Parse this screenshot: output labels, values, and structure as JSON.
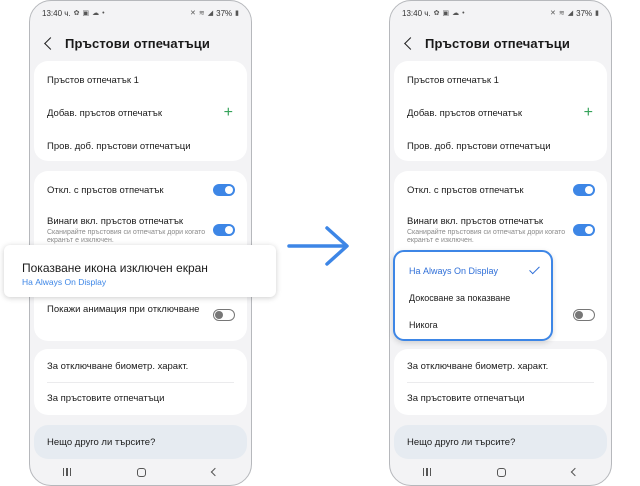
{
  "status_bar": {
    "time": "13:40 ч.",
    "battery": "37%"
  },
  "settings": {
    "title": "Пръстови отпечатъци",
    "card1": [
      {
        "label": "Пръстов отпечатък 1"
      },
      {
        "label": "Добав. пръстов отпечатък"
      },
      {
        "label": "Пров. доб. пръстови отпечатъци"
      }
    ],
    "card2": [
      {
        "label": "Откл. с пръстов отпечатък",
        "toggle": "on"
      },
      {
        "label": "Винаги вкл. пръстов отпечатък",
        "sub": "Сканирайте пръстовия си отпечатък дори когато екранът е изключен.",
        "toggle": "on"
      },
      {
        "label": "Показване икона изключен екран",
        "value": "На Always On Display"
      },
      {
        "label": "Покажи анимация при отключване",
        "toggle": "off"
      }
    ],
    "card3": [
      {
        "label": "За отключване биометр. характ."
      },
      {
        "label": "За пръстовите отпечатъци"
      }
    ],
    "card4": {
      "label": "Нещо друго ли търсите?"
    }
  },
  "popup": {
    "title": "Показване икона изключен екран",
    "value": "На Always On Display"
  },
  "dropdown": {
    "options": [
      {
        "label": "На Always On Display",
        "selected": true
      },
      {
        "label": "Докосване за показване",
        "selected": false
      },
      {
        "label": "Никога",
        "selected": false
      }
    ]
  },
  "colors": {
    "accent": "#3d86e6",
    "plus": "#36a35b",
    "toggle_on": "#3d86e6",
    "bg": "#f3f3f5"
  }
}
